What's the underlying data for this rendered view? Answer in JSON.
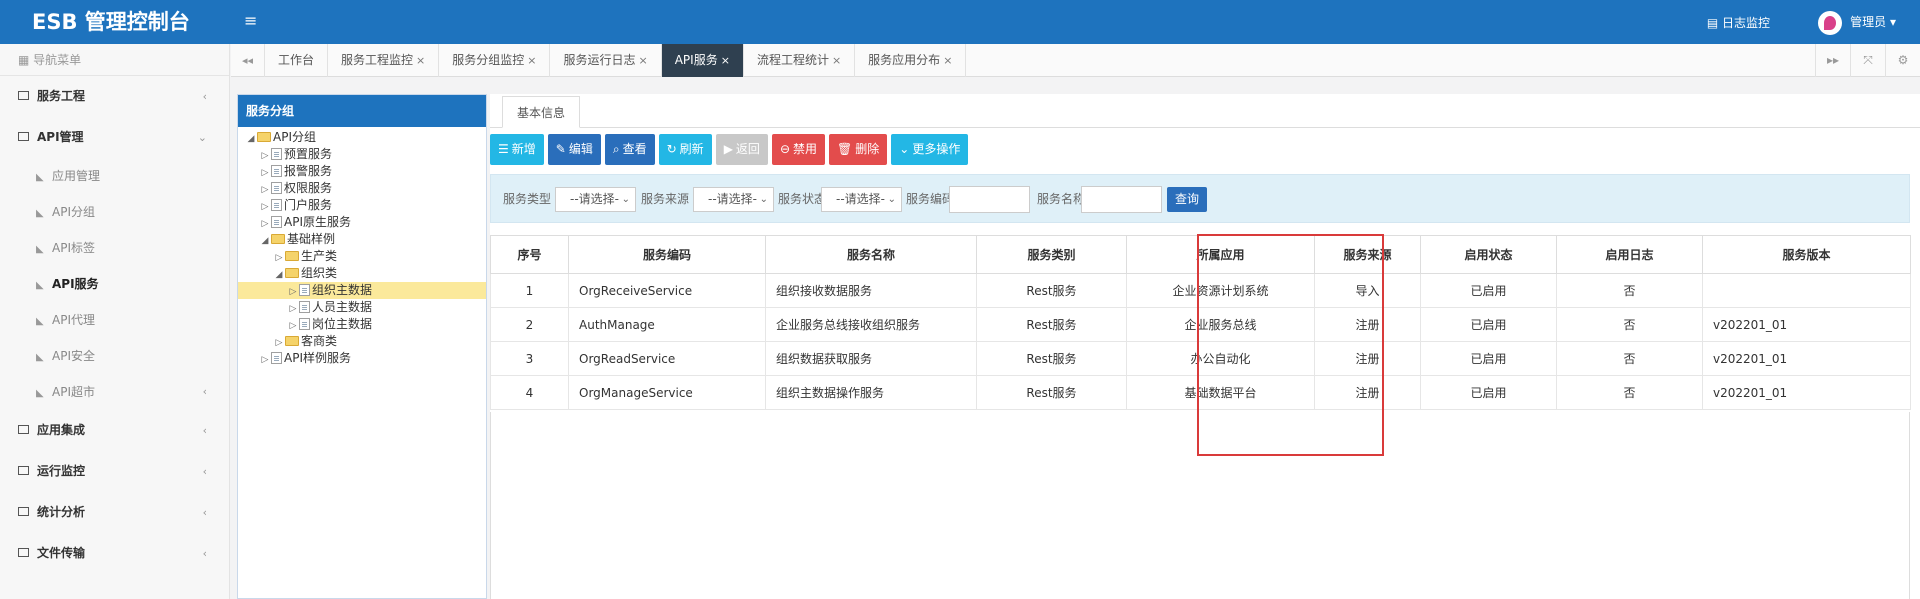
{
  "header": {
    "brand": "ESB 管理控制台",
    "menu_toggle": "≡",
    "log_monitor": "日志监控",
    "user_name": "管理员",
    "user_caret": "▾"
  },
  "sidebar": {
    "nav_title": "导航菜单",
    "groups": [
      {
        "label": "服务工程",
        "chev": "‹"
      },
      {
        "label": "API管理",
        "chev": "⌄"
      }
    ],
    "api_items": [
      {
        "label": "应用管理"
      },
      {
        "label": "API分组"
      },
      {
        "label": "API标签"
      },
      {
        "label": "API服务"
      },
      {
        "label": "API代理"
      },
      {
        "label": "API安全"
      },
      {
        "label": "API超市",
        "chev": "‹"
      }
    ],
    "bottom_groups": [
      {
        "label": "应用集成",
        "chev": "‹"
      },
      {
        "label": "运行监控",
        "chev": "‹"
      },
      {
        "label": "统计分析",
        "chev": "‹"
      },
      {
        "label": "文件传输",
        "chev": "‹"
      }
    ]
  },
  "tabs": {
    "items": [
      {
        "label": "工作台",
        "close": ""
      },
      {
        "label": "服务工程监控",
        "close": "×"
      },
      {
        "label": "服务分组监控",
        "close": "×"
      },
      {
        "label": "服务运行日志",
        "close": "×"
      },
      {
        "label": "API服务",
        "close": "×"
      },
      {
        "label": "流程工程统计",
        "close": "×"
      },
      {
        "label": "服务应用分布",
        "close": "×"
      }
    ],
    "prev": "◂◂",
    "next": "▸▸"
  },
  "tree": {
    "title": "服务分组",
    "nodes": [
      {
        "label": "API分组"
      },
      {
        "label": "预置服务"
      },
      {
        "label": "报警服务"
      },
      {
        "label": "权限服务"
      },
      {
        "label": "门户服务"
      },
      {
        "label": "API原生服务"
      },
      {
        "label": "基础样例"
      },
      {
        "label": "生产类"
      },
      {
        "label": "组织类"
      },
      {
        "label": "组织主数据"
      },
      {
        "label": "人员主数据"
      },
      {
        "label": "岗位主数据"
      },
      {
        "label": "客商类"
      },
      {
        "label": "API样例服务"
      }
    ]
  },
  "main": {
    "inner_tab": "基本信息",
    "toolbar": {
      "add": "新增",
      "edit": "编辑",
      "view": "查看",
      "refresh": "刷新",
      "return": "返回",
      "disable": "禁用",
      "delete": "删除",
      "more": "更多操作"
    },
    "filter": {
      "type_label": "服务类型",
      "type_value": "--请选择-",
      "source_label": "服务来源",
      "source_value": "--请选择-",
      "status_label": "服务状态",
      "status_value": "--请选择-",
      "code_label": "服务编码",
      "code_value": "",
      "name_label": "服务名称",
      "name_value": "",
      "query": "查询"
    },
    "table": {
      "headers": [
        "序号",
        "服务编码",
        "服务名称",
        "服务类别",
        "所属应用",
        "服务来源",
        "启用状态",
        "启用日志",
        "服务版本"
      ],
      "rows": [
        [
          "1",
          "OrgReceiveService",
          "组织接收数据服务",
          "Rest服务",
          "企业资源计划系统",
          "导入",
          "已启用",
          "否",
          ""
        ],
        [
          "2",
          "AuthManage",
          "企业服务总线接收组织服务",
          "Rest服务",
          "企业服务总线",
          "注册",
          "已启用",
          "否",
          "v202201_01"
        ],
        [
          "3",
          "OrgReadService",
          "组织数据获取服务",
          "Rest服务",
          "办公自动化",
          "注册",
          "已启用",
          "否",
          "v202201_01"
        ],
        [
          "4",
          "OrgManageService",
          "组织主数据操作服务",
          "Rest服务",
          "基础数据平台",
          "注册",
          "已启用",
          "否",
          "v202201_01"
        ]
      ]
    }
  }
}
